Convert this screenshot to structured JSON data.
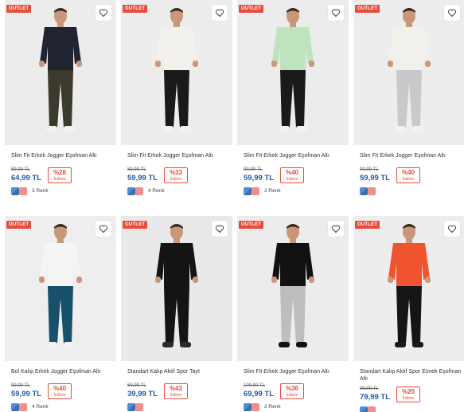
{
  "products": [
    {
      "outlet": "OUTLET",
      "title": "Slim Fit Erkek Jogger Eşofman Altı",
      "old_price": "89,99 TL",
      "price": "64,99 TL",
      "discount": "%28",
      "discount_label": "İndirim",
      "colors": "3 Renk",
      "top": "#1f2430",
      "bottom": "#3c3a2c",
      "shoe": "#f2f2f2",
      "bg": "#ececec"
    },
    {
      "outlet": "OUTLET",
      "title": "Slim Fit Erkek Jogger Eşofman Altı",
      "old_price": "89,99 TL",
      "price": "59,99 TL",
      "discount": "%33",
      "discount_label": "İndirim",
      "colors": "4 Renk",
      "top": "#f3f1ec",
      "bottom": "#1a1a1a",
      "shoe": "#f2f2f2",
      "bg": "#ededed"
    },
    {
      "outlet": "OUTLET",
      "title": "Slim Fit Erkek Jogger Eşofman Altı",
      "old_price": "99,99 TL",
      "price": "59,99 TL",
      "discount": "%40",
      "discount_label": "İndirim",
      "colors": "2 Renk",
      "top": "#bfe3bc",
      "bottom": "#1a1a1a",
      "shoe": "#f2f2f2",
      "bg": "#ececec"
    },
    {
      "outlet": "OUTLET",
      "title": "Slim Fit Erkek Jogger Eşofman Altı",
      "old_price": "99,99 TL",
      "price": "59,99 TL",
      "discount": "%40",
      "discount_label": "İndirim",
      "colors": "",
      "top": "#f2f0ea",
      "bottom": "#c9c9cb",
      "shoe": "#f2f2f2",
      "bg": "#ededed"
    },
    {
      "outlet": "OUTLET",
      "title": "Bol Kalıp Erkek Jogger Eşofman Altı",
      "old_price": "99,99 TL",
      "price": "59,99 TL",
      "discount": "%40",
      "discount_label": "İndirim",
      "colors": "4 Renk",
      "top": "#f4f4f2",
      "bottom": "#16506a",
      "shoe": "#f2f2f2",
      "bg": "#eeeeee"
    },
    {
      "outlet": "OUTLET",
      "title": "Standart Kalıp Aktif Spor Tayt",
      "old_price": "69,99 TL",
      "price": "39,99 TL",
      "discount": "%43",
      "discount_label": "İndirim",
      "colors": "",
      "top": "#141414",
      "bottom": "#141414",
      "shoe": "#2a2a2a",
      "bg": "#e9e9e9"
    },
    {
      "outlet": "OUTLET",
      "title": "Slim Fit Erkek Jogger Eşofman Altı",
      "old_price": "109,99 TL",
      "price": "69,99 TL",
      "discount": "%36",
      "discount_label": "İndirim",
      "colors": "2 Renk",
      "top": "#111111",
      "bottom": "#bdbdbd",
      "shoe": "#111111",
      "bg": "#ececec"
    },
    {
      "outlet": "OUTLET",
      "title": "Standart Kalıp Aktif Spor Esnek Eşofman Altı",
      "old_price": "99,99 TL",
      "price": "79,99 TL",
      "discount": "%20",
      "discount_label": "İndirim",
      "colors": "",
      "top": "#f0532f",
      "bottom": "#151515",
      "shoe": "#1a1a1a",
      "bg": "#ededed"
    }
  ]
}
